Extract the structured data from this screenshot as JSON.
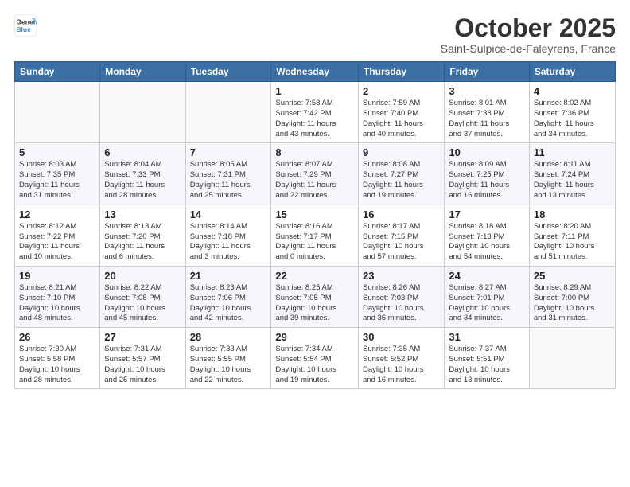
{
  "logo": {
    "line1": "General",
    "line2": "Blue"
  },
  "title": "October 2025",
  "subtitle": "Saint-Sulpice-de-Faleyrens, France",
  "weekdays": [
    "Sunday",
    "Monday",
    "Tuesday",
    "Wednesday",
    "Thursday",
    "Friday",
    "Saturday"
  ],
  "weeks": [
    [
      {
        "day": "",
        "info": ""
      },
      {
        "day": "",
        "info": ""
      },
      {
        "day": "",
        "info": ""
      },
      {
        "day": "1",
        "info": "Sunrise: 7:58 AM\nSunset: 7:42 PM\nDaylight: 11 hours\nand 43 minutes."
      },
      {
        "day": "2",
        "info": "Sunrise: 7:59 AM\nSunset: 7:40 PM\nDaylight: 11 hours\nand 40 minutes."
      },
      {
        "day": "3",
        "info": "Sunrise: 8:01 AM\nSunset: 7:38 PM\nDaylight: 11 hours\nand 37 minutes."
      },
      {
        "day": "4",
        "info": "Sunrise: 8:02 AM\nSunset: 7:36 PM\nDaylight: 11 hours\nand 34 minutes."
      }
    ],
    [
      {
        "day": "5",
        "info": "Sunrise: 8:03 AM\nSunset: 7:35 PM\nDaylight: 11 hours\nand 31 minutes."
      },
      {
        "day": "6",
        "info": "Sunrise: 8:04 AM\nSunset: 7:33 PM\nDaylight: 11 hours\nand 28 minutes."
      },
      {
        "day": "7",
        "info": "Sunrise: 8:05 AM\nSunset: 7:31 PM\nDaylight: 11 hours\nand 25 minutes."
      },
      {
        "day": "8",
        "info": "Sunrise: 8:07 AM\nSunset: 7:29 PM\nDaylight: 11 hours\nand 22 minutes."
      },
      {
        "day": "9",
        "info": "Sunrise: 8:08 AM\nSunset: 7:27 PM\nDaylight: 11 hours\nand 19 minutes."
      },
      {
        "day": "10",
        "info": "Sunrise: 8:09 AM\nSunset: 7:25 PM\nDaylight: 11 hours\nand 16 minutes."
      },
      {
        "day": "11",
        "info": "Sunrise: 8:11 AM\nSunset: 7:24 PM\nDaylight: 11 hours\nand 13 minutes."
      }
    ],
    [
      {
        "day": "12",
        "info": "Sunrise: 8:12 AM\nSunset: 7:22 PM\nDaylight: 11 hours\nand 10 minutes."
      },
      {
        "day": "13",
        "info": "Sunrise: 8:13 AM\nSunset: 7:20 PM\nDaylight: 11 hours\nand 6 minutes."
      },
      {
        "day": "14",
        "info": "Sunrise: 8:14 AM\nSunset: 7:18 PM\nDaylight: 11 hours\nand 3 minutes."
      },
      {
        "day": "15",
        "info": "Sunrise: 8:16 AM\nSunset: 7:17 PM\nDaylight: 11 hours\nand 0 minutes."
      },
      {
        "day": "16",
        "info": "Sunrise: 8:17 AM\nSunset: 7:15 PM\nDaylight: 10 hours\nand 57 minutes."
      },
      {
        "day": "17",
        "info": "Sunrise: 8:18 AM\nSunset: 7:13 PM\nDaylight: 10 hours\nand 54 minutes."
      },
      {
        "day": "18",
        "info": "Sunrise: 8:20 AM\nSunset: 7:11 PM\nDaylight: 10 hours\nand 51 minutes."
      }
    ],
    [
      {
        "day": "19",
        "info": "Sunrise: 8:21 AM\nSunset: 7:10 PM\nDaylight: 10 hours\nand 48 minutes."
      },
      {
        "day": "20",
        "info": "Sunrise: 8:22 AM\nSunset: 7:08 PM\nDaylight: 10 hours\nand 45 minutes."
      },
      {
        "day": "21",
        "info": "Sunrise: 8:23 AM\nSunset: 7:06 PM\nDaylight: 10 hours\nand 42 minutes."
      },
      {
        "day": "22",
        "info": "Sunrise: 8:25 AM\nSunset: 7:05 PM\nDaylight: 10 hours\nand 39 minutes."
      },
      {
        "day": "23",
        "info": "Sunrise: 8:26 AM\nSunset: 7:03 PM\nDaylight: 10 hours\nand 36 minutes."
      },
      {
        "day": "24",
        "info": "Sunrise: 8:27 AM\nSunset: 7:01 PM\nDaylight: 10 hours\nand 34 minutes."
      },
      {
        "day": "25",
        "info": "Sunrise: 8:29 AM\nSunset: 7:00 PM\nDaylight: 10 hours\nand 31 minutes."
      }
    ],
    [
      {
        "day": "26",
        "info": "Sunrise: 7:30 AM\nSunset: 5:58 PM\nDaylight: 10 hours\nand 28 minutes."
      },
      {
        "day": "27",
        "info": "Sunrise: 7:31 AM\nSunset: 5:57 PM\nDaylight: 10 hours\nand 25 minutes."
      },
      {
        "day": "28",
        "info": "Sunrise: 7:33 AM\nSunset: 5:55 PM\nDaylight: 10 hours\nand 22 minutes."
      },
      {
        "day": "29",
        "info": "Sunrise: 7:34 AM\nSunset: 5:54 PM\nDaylight: 10 hours\nand 19 minutes."
      },
      {
        "day": "30",
        "info": "Sunrise: 7:35 AM\nSunset: 5:52 PM\nDaylight: 10 hours\nand 16 minutes."
      },
      {
        "day": "31",
        "info": "Sunrise: 7:37 AM\nSunset: 5:51 PM\nDaylight: 10 hours\nand 13 minutes."
      },
      {
        "day": "",
        "info": ""
      }
    ]
  ]
}
